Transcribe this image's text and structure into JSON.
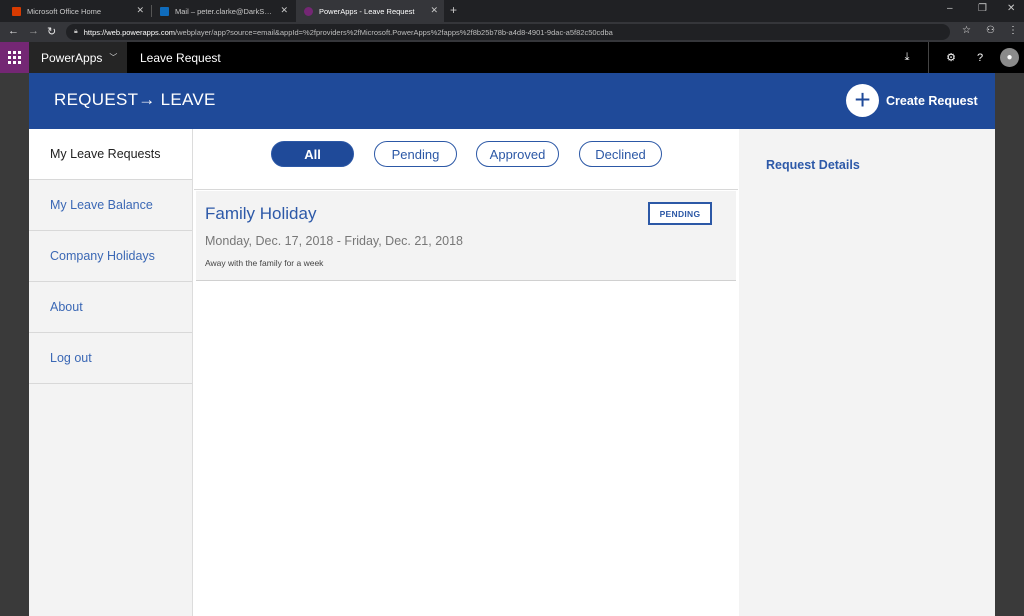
{
  "browser": {
    "tabs": [
      {
        "label": "Microsoft Office Home",
        "icon": "office-icon",
        "color": "#d83b01"
      },
      {
        "label": "Mail – peter.clarke@DarkScrolls...",
        "icon": "outlook-icon",
        "color": "#0f6cbd"
      },
      {
        "label": "PowerApps - Leave Request",
        "icon": "powerapps-icon",
        "color": "#742774"
      }
    ],
    "url_host": "https://web.powerapps.com",
    "url_rest": "/webplayer/app?source=email&appId=%2fproviders%2fMicrosoft.PowerApps%2fapps%2f8b25b78b-a4d8-4901-9dac-a5f82c50cdba"
  },
  "powerapps_bar": {
    "brand": "PowerApps",
    "app_name": "Leave Request"
  },
  "app": {
    "title": "REQUEST→ LEAVE",
    "create_label": "Create Request",
    "nav": [
      {
        "label": "My Leave Requests",
        "selected": true
      },
      {
        "label": "My Leave Balance",
        "selected": false
      },
      {
        "label": "Company Holidays",
        "selected": false
      },
      {
        "label": "About",
        "selected": false
      },
      {
        "label": "Log out",
        "selected": false
      }
    ],
    "filters": [
      {
        "label": "All",
        "active": true
      },
      {
        "label": "Pending",
        "active": false
      },
      {
        "label": "Approved",
        "active": false
      },
      {
        "label": "Declined",
        "active": false
      }
    ],
    "requests": [
      {
        "title": "Family Holiday",
        "status": "PENDING",
        "dates": "Monday, Dec. 17, 2018 - Friday, Dec. 21, 2018",
        "description": "Away with the family for a week"
      }
    ],
    "details_title": "Request Details"
  },
  "colors": {
    "header_blue": "#1f4a99",
    "link_blue": "#2d59a8",
    "powerapps_purple": "#742774"
  }
}
